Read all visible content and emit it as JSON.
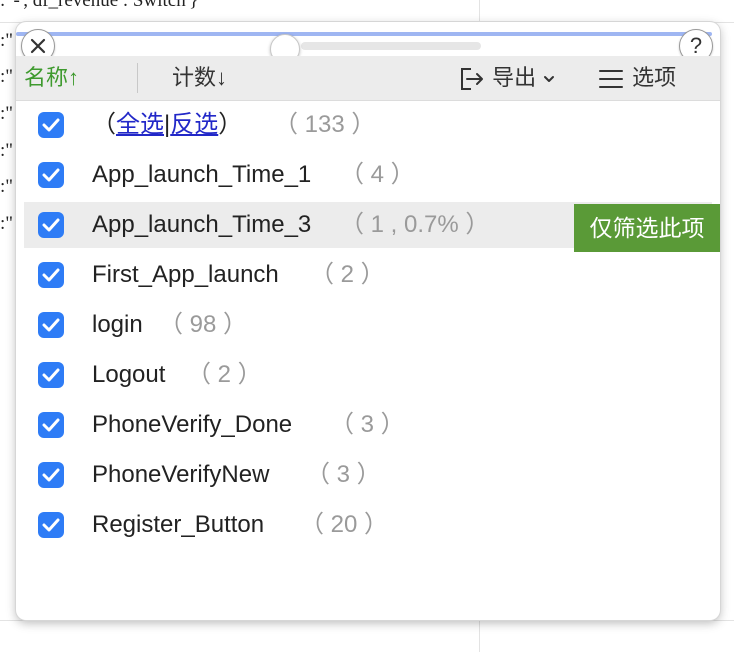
{
  "background": {
    "code_text": ": '-', df_revenue : Switch'}",
    "row_marker": ":\""
  },
  "panel": {
    "help_label": "?",
    "toolbar": {
      "sort_name_label": "名称",
      "sort_name_arrow": "↑",
      "sort_count_label": "计数",
      "sort_count_arrow": "↓",
      "export_label": "导出",
      "export_caret": "⌄",
      "options_label": "选项"
    },
    "select_all_row": {
      "open": "（",
      "select_all": "全选",
      "divider": "|",
      "invert": "反选",
      "close": "）",
      "count": "（ 133 ）"
    },
    "items": [
      {
        "label": "App_launch_Time_1",
        "count": "（ 4 ）"
      },
      {
        "label": "App_launch_Time_3",
        "count": "（ 1 , 0.7% ）"
      },
      {
        "label": "First_App_launch",
        "count": "（ 2 ）"
      },
      {
        "label": "login",
        "count": "（ 98 ）"
      },
      {
        "label": "Logout",
        "count": "（ 2 ）"
      },
      {
        "label": "PhoneVerify_Done",
        "count": "（ 3 ）"
      },
      {
        "label": "PhoneVerifyNew",
        "count": "（ 3 ）"
      },
      {
        "label": "Register_Button",
        "count": "（ 20 ）"
      }
    ],
    "filter_only_label": "仅筛选此项"
  },
  "colors": {
    "checkbox": "#2e7cf6",
    "accent_green": "#3e9a2e",
    "filter_button": "#5a9a37",
    "link": "#2228c8"
  }
}
